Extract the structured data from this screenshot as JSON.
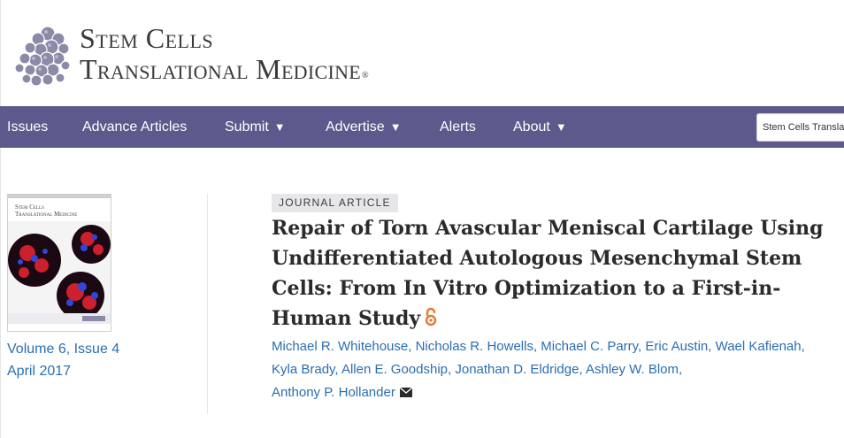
{
  "header": {
    "brand_line1": "Stem Cells",
    "brand_line2": "Translational Medicine",
    "registered_mark": "®"
  },
  "nav": {
    "items": [
      {
        "label": "Issues",
        "has_dropdown": false
      },
      {
        "label": "Advance Articles",
        "has_dropdown": false
      },
      {
        "label": "Submit",
        "has_dropdown": true
      },
      {
        "label": "Advertise",
        "has_dropdown": true
      },
      {
        "label": "Alerts",
        "has_dropdown": false
      },
      {
        "label": "About",
        "has_dropdown": true
      }
    ],
    "dropdown_caret": "▼",
    "search_value": "Stem Cells Transla"
  },
  "issue": {
    "cover_title_line1": "Stem Cells",
    "cover_title_line2": "Translational Medicine",
    "volume_issue": "Volume 6, Issue 4",
    "date": "April 2017"
  },
  "article": {
    "type_label": "JOURNAL ARTICLE",
    "title": "Repair of Torn Avascular Meniscal Cartilage Using Undifferentiated Autologous Mesenchymal Stem Cells: From In Vitro Optimization to a First-in-Human Study",
    "open_access_icon": "open-access-icon",
    "authors": [
      "Michael R. Whitehouse",
      "Nicholas R. Howells",
      "Michael C. Parry",
      "Eric Austin",
      "Wael Kafienah",
      "Kyla Brady",
      "Allen E. Goodship",
      "Jonathan D. Eldridge",
      "Ashley W. Blom",
      "Anthony P. Hollander"
    ],
    "author_separator": ",",
    "corresponding_icon": "envelope-icon"
  },
  "colors": {
    "nav_bg": "#5c5a8c",
    "link": "#2a6eb1",
    "title": "#2b2b2b",
    "tag_bg": "#e7e7ea",
    "open_access": "#e8782c"
  }
}
